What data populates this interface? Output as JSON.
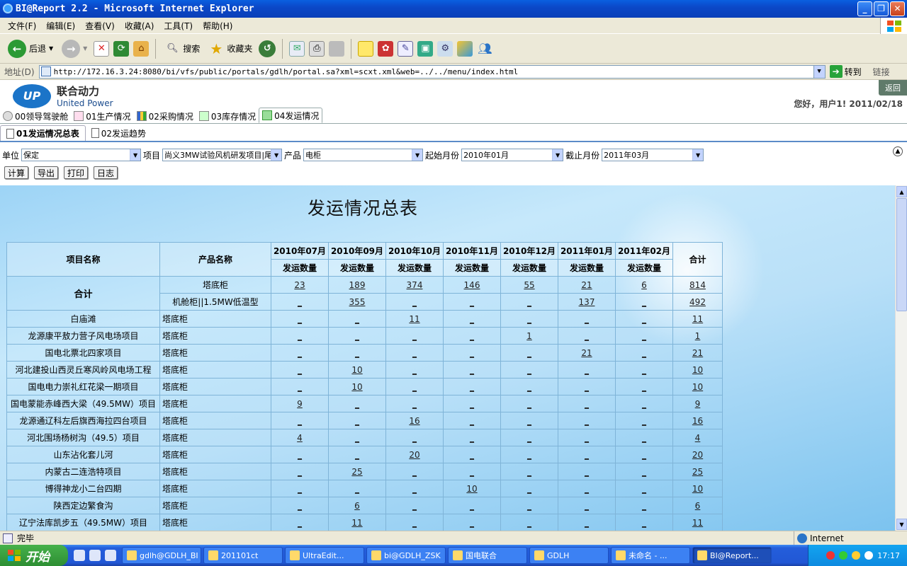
{
  "window": {
    "title": "BI@Report 2.2 - Microsoft Internet Explorer"
  },
  "menu": [
    "文件(F)",
    "编辑(E)",
    "查看(V)",
    "收藏(A)",
    "工具(T)",
    "帮助(H)"
  ],
  "toolbar": {
    "back": "后退",
    "search": "搜索",
    "favorites": "收藏夹"
  },
  "address": {
    "label": "地址(D)",
    "url": "http://172.16.3.24:8080/bi/vfs/public/portals/gdlh/portal.sa?xml=scxt.xml&web=../../menu/index.html",
    "go": "转到",
    "links": "链接"
  },
  "brand": {
    "cn": "联合动力",
    "en": "United Power",
    "mark": "UP"
  },
  "back_button": "返回",
  "greeting": "您好，用户1! 2011/02/18",
  "nav_tabs": [
    "00领导驾驶舱",
    "01生产情况",
    "02采购情况",
    "03库存情况",
    "04发运情况"
  ],
  "sub_tabs": [
    "01发运情况总表",
    "02发运趋势"
  ],
  "filters": {
    "unit_label": "单位",
    "unit_value": "保定",
    "project_label": "项目",
    "project_value": "尚义3MW试验风机研发项目|尾",
    "product_label": "产品",
    "product_value": "电柜",
    "start_label": "起始月份",
    "start_value": "2010年01月",
    "end_label": "截止月份",
    "end_value": "2011年03月"
  },
  "actions": {
    "calc": "计算",
    "export": "导出",
    "print": "打印",
    "log": "日志"
  },
  "report": {
    "title": "发运情况总表",
    "col_project": "项目名称",
    "col_product": "产品名称",
    "col_total": "合计",
    "qty_label": "发运数量",
    "months": [
      "2010年07月",
      "2010年09月",
      "2010年10月",
      "2010年11月",
      "2010年12月",
      "2011年01月",
      "2011年02月"
    ],
    "total_label": "合计",
    "total_rows": [
      {
        "product": "塔底柜",
        "values": [
          "23",
          "189",
          "374",
          "146",
          "55",
          "21",
          "6"
        ],
        "total": "814"
      },
      {
        "product": "机舱柜||1.5MW低温型",
        "values": [
          "_",
          "355",
          "_",
          "_",
          "_",
          "137",
          "_"
        ],
        "total": "492"
      }
    ],
    "rows": [
      {
        "project": "白庙滩",
        "product": "塔底柜",
        "values": [
          "_",
          "_",
          "11",
          "_",
          "_",
          "_",
          "_"
        ],
        "total": "11"
      },
      {
        "project": "龙源康平敖力营子风电场项目",
        "product": "塔底柜",
        "values": [
          "_",
          "_",
          "_",
          "_",
          "1",
          "_",
          "_"
        ],
        "total": "1"
      },
      {
        "project": "国电北票北四家项目",
        "product": "塔底柜",
        "values": [
          "_",
          "_",
          "_",
          "_",
          "_",
          "21",
          "_"
        ],
        "total": "21"
      },
      {
        "project": "河北建投山西灵丘寒风岭风电场工程",
        "product": "塔底柜",
        "values": [
          "_",
          "10",
          "_",
          "_",
          "_",
          "_",
          "_"
        ],
        "total": "10"
      },
      {
        "project": "国电电力崇礼红花梁一期项目",
        "product": "塔底柜",
        "values": [
          "_",
          "10",
          "_",
          "_",
          "_",
          "_",
          "_"
        ],
        "total": "10"
      },
      {
        "project": "国电蒙能赤峰西大梁（49.5MW）项目",
        "product": "塔底柜",
        "values": [
          "9",
          "_",
          "_",
          "_",
          "_",
          "_",
          "_"
        ],
        "total": "9"
      },
      {
        "project": "龙源通辽科左后旗西海拉四台项目",
        "product": "塔底柜",
        "values": [
          "_",
          "_",
          "16",
          "_",
          "_",
          "_",
          "_"
        ],
        "total": "16"
      },
      {
        "project": "河北围场杨树沟（49.5）项目",
        "product": "塔底柜",
        "values": [
          "4",
          "_",
          "_",
          "_",
          "_",
          "_",
          "_"
        ],
        "total": "4"
      },
      {
        "project": "山东沾化套儿河",
        "product": "塔底柜",
        "values": [
          "_",
          "_",
          "20",
          "_",
          "_",
          "_",
          "_"
        ],
        "total": "20"
      },
      {
        "project": "内蒙古二连浩特项目",
        "product": "塔底柜",
        "values": [
          "_",
          "25",
          "_",
          "_",
          "_",
          "_",
          "_"
        ],
        "total": "25"
      },
      {
        "project": "博得神龙小二台四期",
        "product": "塔底柜",
        "values": [
          "_",
          "_",
          "_",
          "10",
          "_",
          "_",
          "_"
        ],
        "total": "10"
      },
      {
        "project": "陕西定边繁食沟",
        "product": "塔底柜",
        "values": [
          "_",
          "6",
          "_",
          "_",
          "_",
          "_",
          "_"
        ],
        "total": "6"
      },
      {
        "project": "辽宁法库凯步五（49.5MW）项目",
        "product": "塔底柜",
        "values": [
          "_",
          "11",
          "_",
          "_",
          "_",
          "_",
          "_"
        ],
        "total": "11"
      }
    ]
  },
  "status": {
    "text": "完毕",
    "zone": "Internet"
  },
  "taskbar": {
    "start": "开始",
    "tasks": [
      "gdlh@GDLH_BI",
      "201101ct",
      "UltraEdit...",
      "bi@GDLH_ZSK",
      "国电联合",
      "GDLH",
      "未命名 - ...",
      "BI@Report..."
    ],
    "clock": "17:17"
  }
}
